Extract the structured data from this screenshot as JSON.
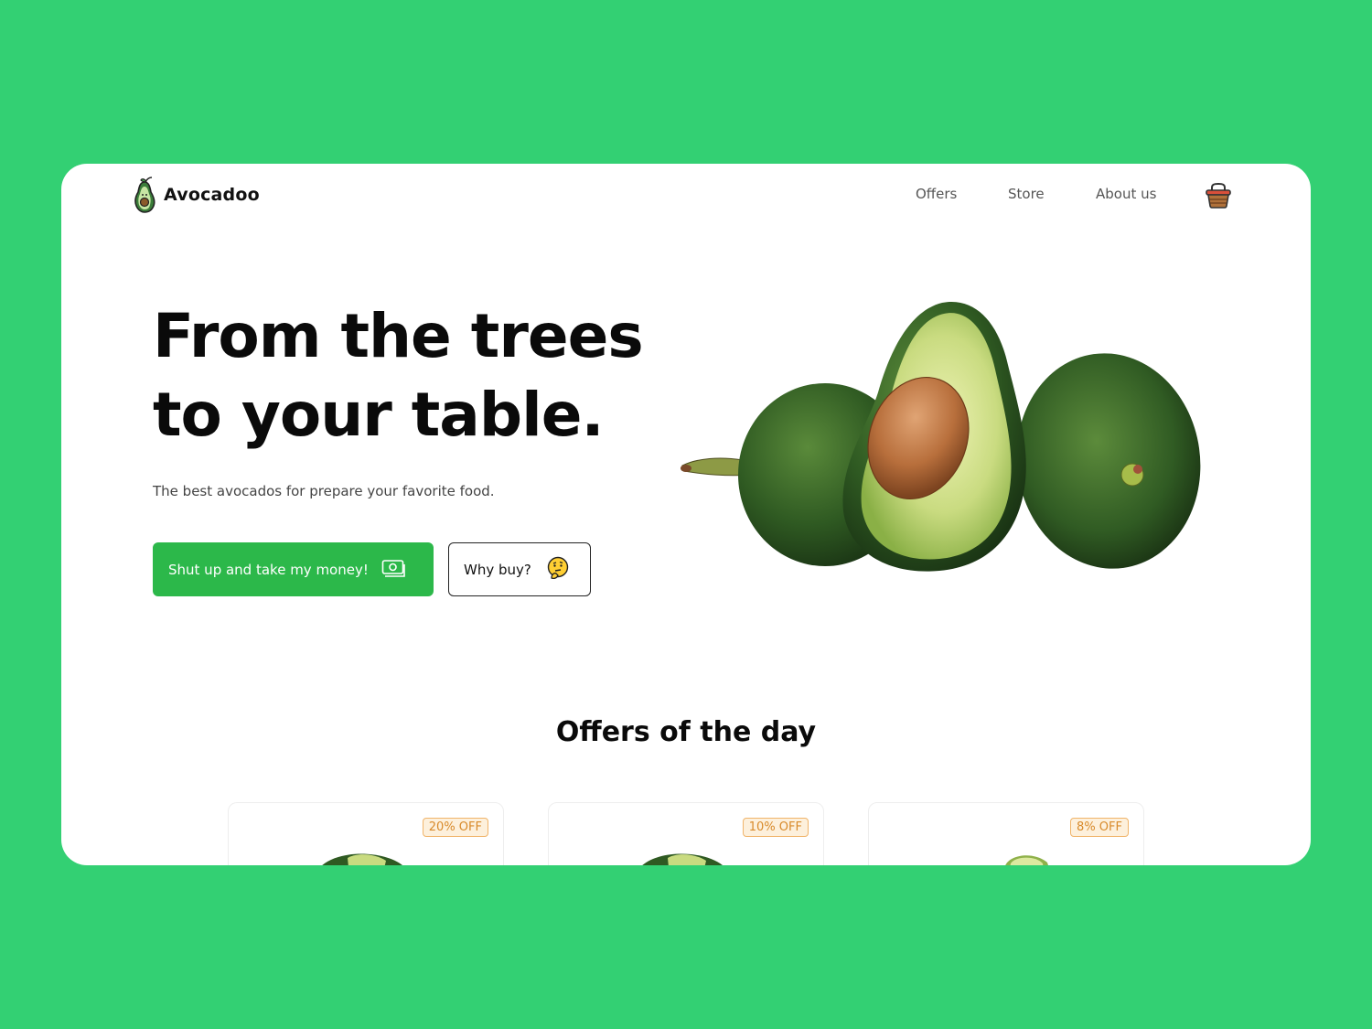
{
  "header": {
    "brand": "Avocadoo",
    "nav": [
      {
        "label": "Offers"
      },
      {
        "label": "Store"
      },
      {
        "label": "About us"
      }
    ],
    "cart_icon": "basket-icon"
  },
  "hero": {
    "title_line1": "From the trees",
    "title_line2": "to your table.",
    "subtitle": "The best avocados for prepare your favorite food.",
    "primary_button": "Shut up and take my money!",
    "primary_icon": "money-icon",
    "secondary_button": "Why buy?",
    "secondary_icon": "thinking-face-icon"
  },
  "offers": {
    "title": "Offers of the day",
    "cards": [
      {
        "badge": "20% OFF"
      },
      {
        "badge": "10% OFF"
      },
      {
        "badge": "8% OFF"
      }
    ]
  },
  "colors": {
    "background": "#33d073",
    "primary": "#2cb84a",
    "badge_text": "#d88a2a"
  }
}
